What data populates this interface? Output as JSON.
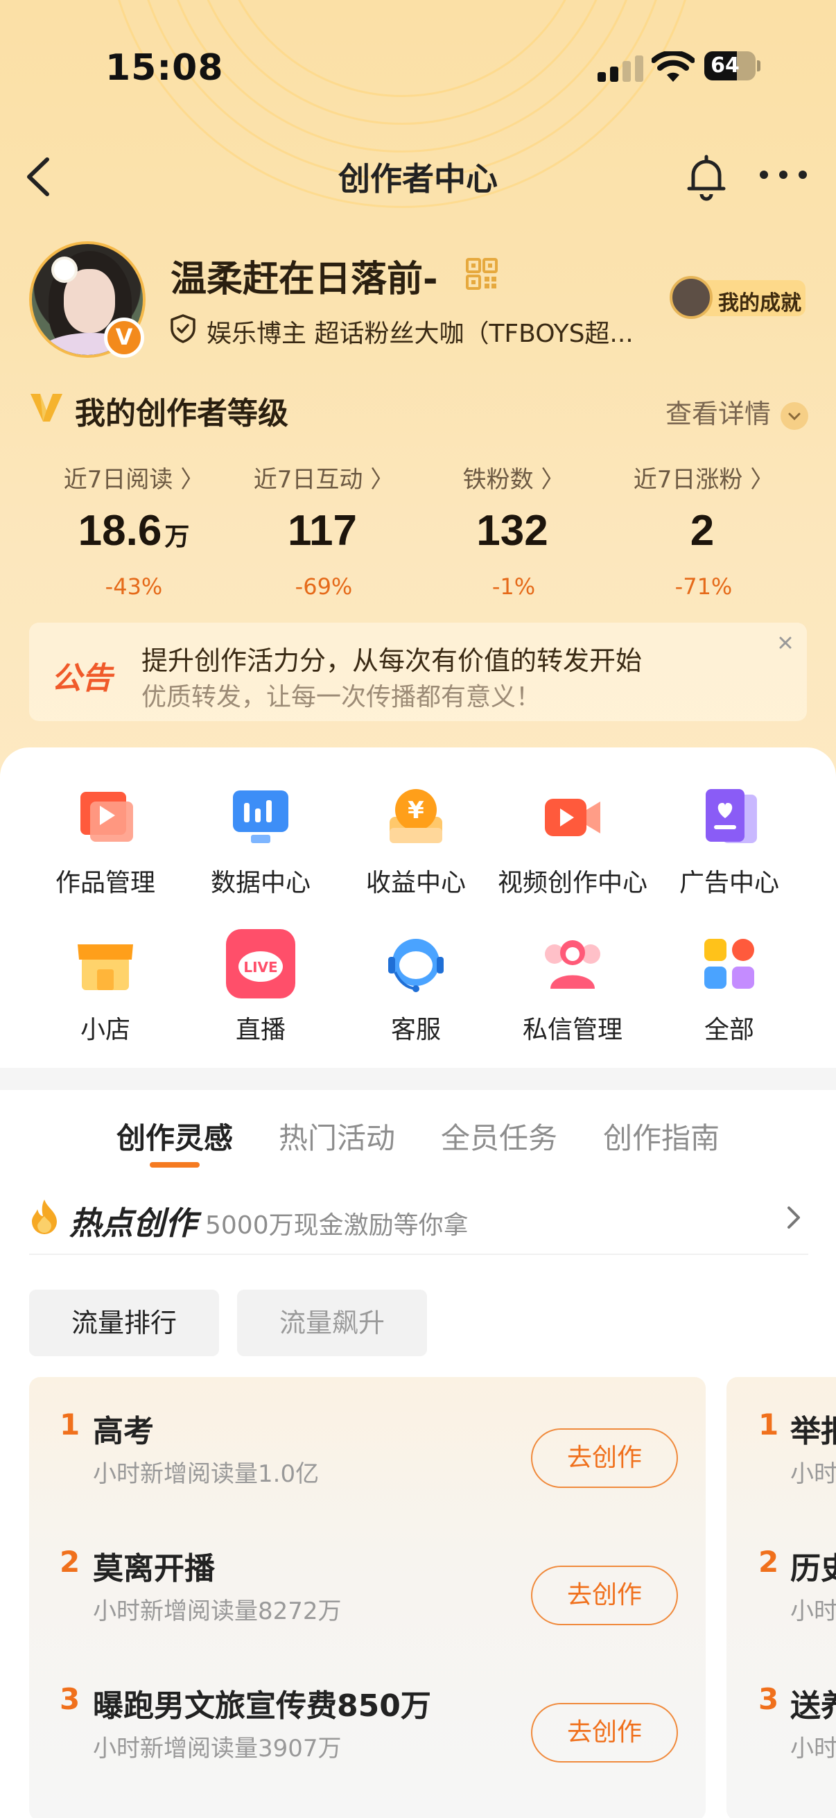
{
  "status_bar": {
    "time": "15:08",
    "battery": "64",
    "battery_level": 0.64
  },
  "nav": {
    "title": "创作者中心"
  },
  "profile": {
    "name": "温柔赶在日落前-",
    "tags": "娱乐博主 超话粉丝大咖（TFBOYS超...",
    "badge": "V",
    "achievement": "我的成就"
  },
  "level": {
    "title": "我的创作者等级",
    "details": "查看详情"
  },
  "stats": [
    {
      "label": "近7日阅读 〉",
      "value": "18.6",
      "unit": "万",
      "change": "-43%"
    },
    {
      "label": "近7日互动 〉",
      "value": "117",
      "unit": "",
      "change": "-69%"
    },
    {
      "label": "铁粉数 〉",
      "value": "132",
      "unit": "",
      "change": "-1%"
    },
    {
      "label": "近7日涨粉 〉",
      "value": "2",
      "unit": "",
      "change": "-71%"
    }
  ],
  "notice": {
    "tag": "公告",
    "line1": "提升创作活力分，从每次有价值的转发开始",
    "line2": "优质转发，让每一次传播都有意义！"
  },
  "tools": [
    {
      "label": "作品管理",
      "icon": "works-icon"
    },
    {
      "label": "数据中心",
      "icon": "data-icon"
    },
    {
      "label": "收益中心",
      "icon": "income-icon"
    },
    {
      "label": "视频创作中心",
      "icon": "video-icon"
    },
    {
      "label": "广告中心",
      "icon": "ad-icon"
    },
    {
      "label": "小店",
      "icon": "shop-icon"
    },
    {
      "label": "直播",
      "icon": "live-icon"
    },
    {
      "label": "客服",
      "icon": "service-icon"
    },
    {
      "label": "私信管理",
      "icon": "message-icon"
    },
    {
      "label": "全部",
      "icon": "all-icon"
    }
  ],
  "tabs": [
    "创作灵感",
    "热门活动",
    "全员任务",
    "创作指南"
  ],
  "hot": {
    "title": "热点创作",
    "subtitle": "5000万现金激励等你拿"
  },
  "chips": [
    "流量排行",
    "流量飙升"
  ],
  "ranking": [
    {
      "num": "1",
      "title": "高考",
      "sub": "小时新增阅读量1.0亿",
      "button": "去创作"
    },
    {
      "num": "2",
      "title": "莫离开播",
      "sub": "小时新增阅读量8272万",
      "button": "去创作"
    },
    {
      "num": "3",
      "title": "曝跑男文旅宣传费850万",
      "sub": "小时新增阅读量3907万",
      "button": "去创作"
    }
  ],
  "ranking2": [
    {
      "num": "1",
      "title": "举报",
      "sub": "小时"
    },
    {
      "num": "2",
      "title": "历史",
      "sub": "小时"
    },
    {
      "num": "3",
      "title": "送养",
      "sub": "小时"
    }
  ]
}
